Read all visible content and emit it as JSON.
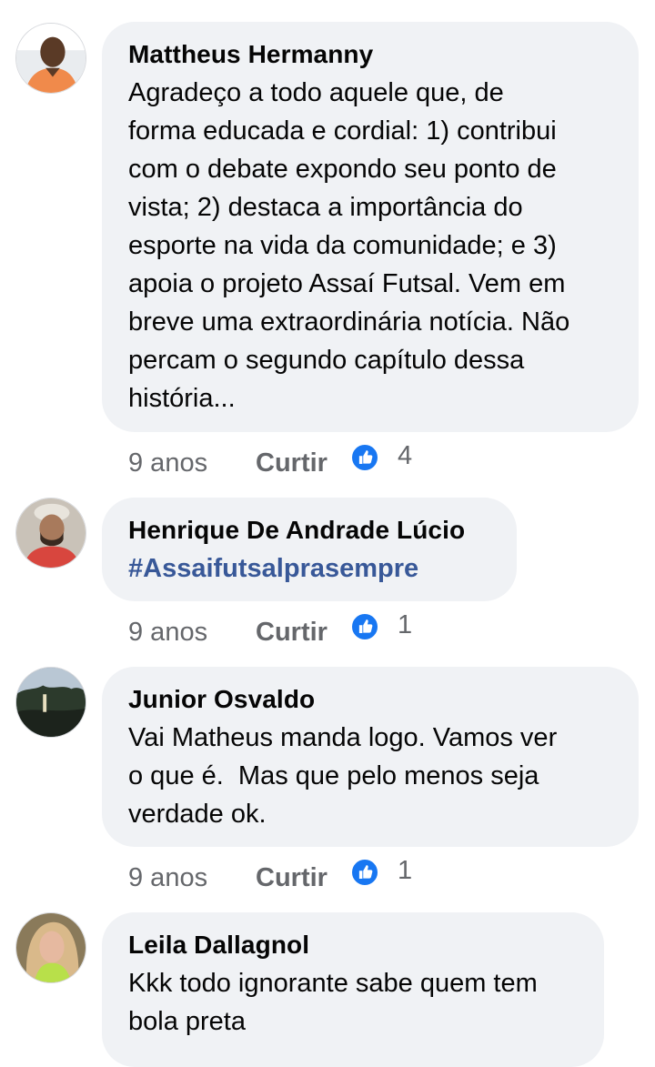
{
  "colors": {
    "bubble": "#f0f2f5",
    "hashtag": "#385898",
    "meta_text": "#65676b",
    "like_blue": "#1877f2"
  },
  "comments": [
    {
      "author": "Mattheus Hermanny",
      "text": "Agradeço a todo aquele que, de\nforma educada e cordial: 1) contribui\ncom o debate expondo seu ponto de\nvista; 2) destaca a importância do\nesporte na vida da comunidade; e 3)\napoia o projeto Assaí Futsal. Vem em\nbreve uma extraordinária notícia. Não\npercam o segundo capítulo dessa\nhistória...",
      "time": "9 anos",
      "like_label": "Curtir",
      "reaction_icon": "like-icon",
      "reaction_count": "4"
    },
    {
      "author": "Henrique De Andrade Lúcio",
      "text": "#Assaifutsalprasempre",
      "time": "9 anos",
      "like_label": "Curtir",
      "reaction_icon": "like-icon",
      "reaction_count": "1"
    },
    {
      "author": "Junior Osvaldo",
      "text": "Vai Matheus manda logo. Vamos ver\no que é.  Mas que pelo menos seja\nverdade ok.",
      "time": "9 anos",
      "like_label": "Curtir",
      "reaction_icon": "like-icon",
      "reaction_count": "1"
    },
    {
      "author": "Leila Dallagnol",
      "text": "Kkk todo ignorante sabe quem tem\nbola preta"
    }
  ]
}
